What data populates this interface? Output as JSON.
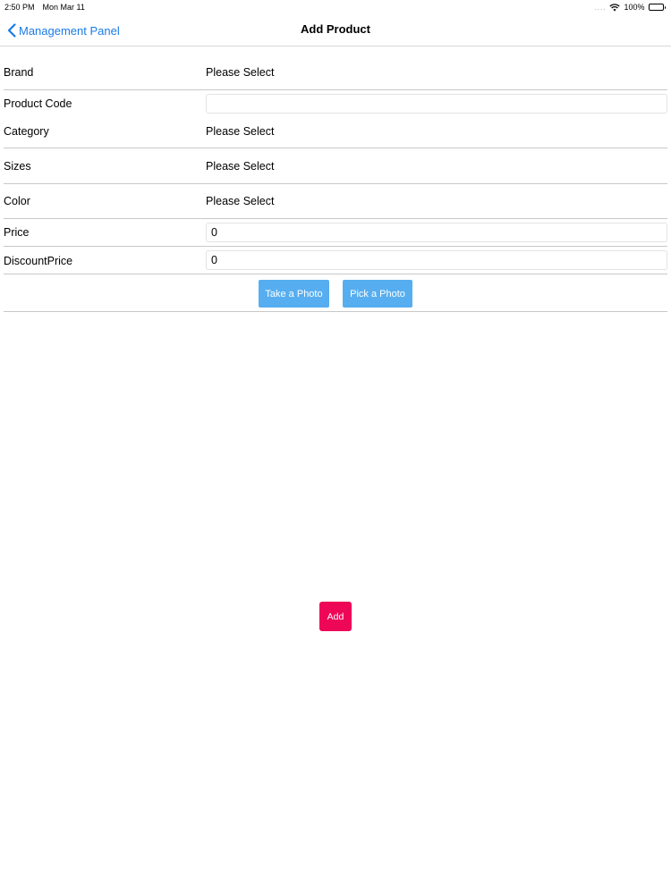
{
  "status_bar": {
    "time": "2:50 PM",
    "date": "Mon Mar 11",
    "signal": "....",
    "battery": "100%"
  },
  "nav": {
    "back_label": "Management Panel",
    "title": "Add Product"
  },
  "form": {
    "brand": {
      "label": "Brand",
      "value": "Please Select"
    },
    "product_code": {
      "label": "Product Code",
      "value": ""
    },
    "category": {
      "label": "Category",
      "value": "Please Select"
    },
    "sizes": {
      "label": "Sizes",
      "value": "Please Select"
    },
    "color": {
      "label": "Color",
      "value": "Please Select"
    },
    "price": {
      "label": "Price",
      "value": "0"
    },
    "discount_price": {
      "label": "DiscountPrice",
      "value": "0"
    }
  },
  "photo_buttons": {
    "take_label": "Take a Photo",
    "pick_label": "Pick a Photo"
  },
  "add_label": "Add",
  "colors": {
    "accent_blue": "#1a7be6",
    "photo_button": "#56aef0",
    "add_button": "#ee0756"
  },
  "icons": {
    "back": "chevron-left-icon",
    "wifi": "wifi-icon",
    "battery": "battery-icon"
  }
}
